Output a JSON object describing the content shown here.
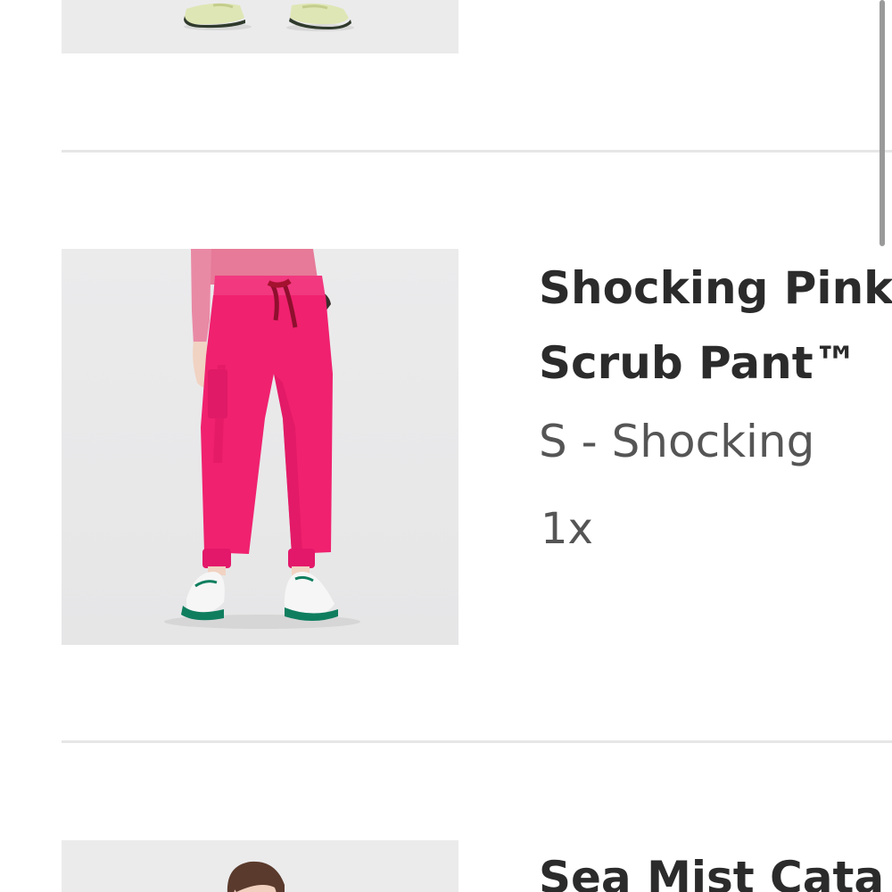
{
  "cart_items": [
    {
      "name": "",
      "variant": "",
      "quantity": ""
    },
    {
      "name_line1": "Shocking Pink",
      "name_line2": "Scrub Pant™",
      "variant": "S - Shocking",
      "quantity": "1x",
      "accent_color": "#f0216f"
    },
    {
      "name_line1": "Sea Mist Cata",
      "accent_color": "#d9dfbf"
    }
  ],
  "colors": {
    "divider": "#e6e6e6",
    "thumb_background": "#ececec",
    "title_text": "#2b2b2b",
    "secondary_text": "#555555",
    "scrollbar": "#9a9a9a"
  }
}
